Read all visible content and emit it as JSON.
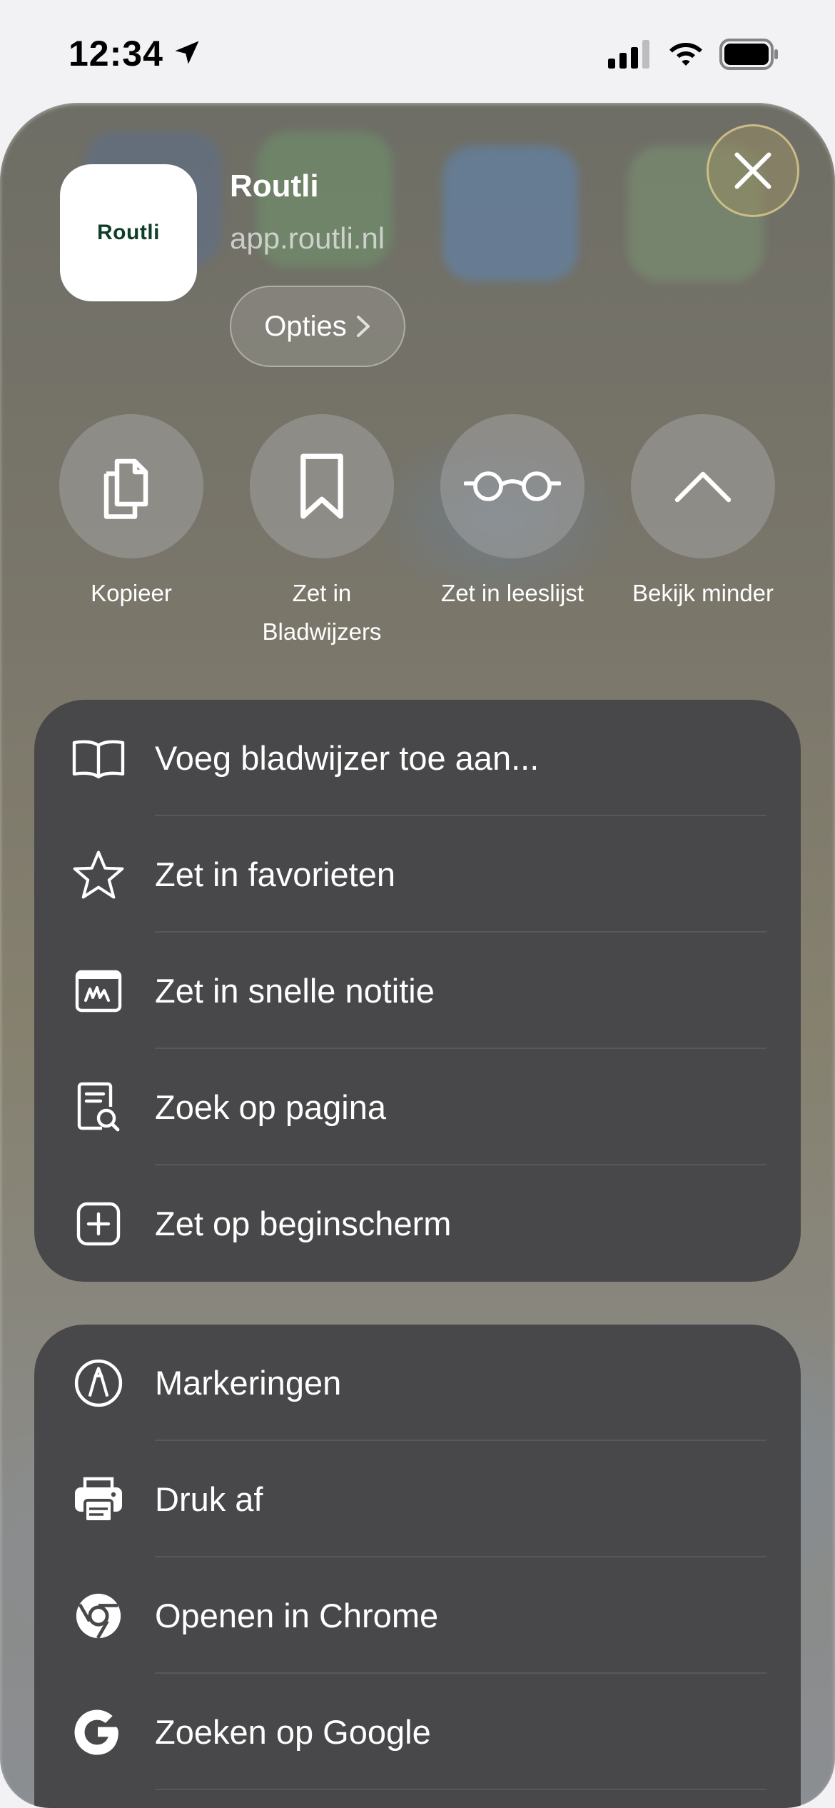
{
  "status_bar": {
    "time": "12:34"
  },
  "app": {
    "name": "Routli",
    "url": "app.routli.nl",
    "logo_text": "Routli",
    "options_label": "Opties"
  },
  "actions": [
    {
      "label": "Kopieer",
      "icon": "copy-icon"
    },
    {
      "label": "Zet in\nBladwijzers",
      "icon": "bookmark-icon"
    },
    {
      "label": "Zet in leeslijst",
      "icon": "glasses-icon"
    },
    {
      "label": "Bekijk minder",
      "icon": "chevron-up-icon"
    }
  ],
  "menu_group_1": [
    {
      "label": "Voeg bladwijzer toe aan...",
      "icon": "book-icon"
    },
    {
      "label": "Zet in favorieten",
      "icon": "star-icon"
    },
    {
      "label": "Zet in snelle notitie",
      "icon": "quick-note-icon"
    },
    {
      "label": "Zoek op pagina",
      "icon": "find-in-page-icon"
    },
    {
      "label": "Zet op beginscherm",
      "icon": "add-square-icon"
    }
  ],
  "menu_group_2": [
    {
      "label": "Markeringen",
      "icon": "markup-icon"
    },
    {
      "label": "Druk af",
      "icon": "printer-icon"
    },
    {
      "label": "Openen in Chrome",
      "icon": "chrome-icon"
    },
    {
      "label": "Zoeken op Google",
      "icon": "google-icon"
    }
  ],
  "colors": {
    "card_background": "#48484a",
    "logo_green": "#0f3e2a",
    "close_ring": "#d7c88c"
  }
}
